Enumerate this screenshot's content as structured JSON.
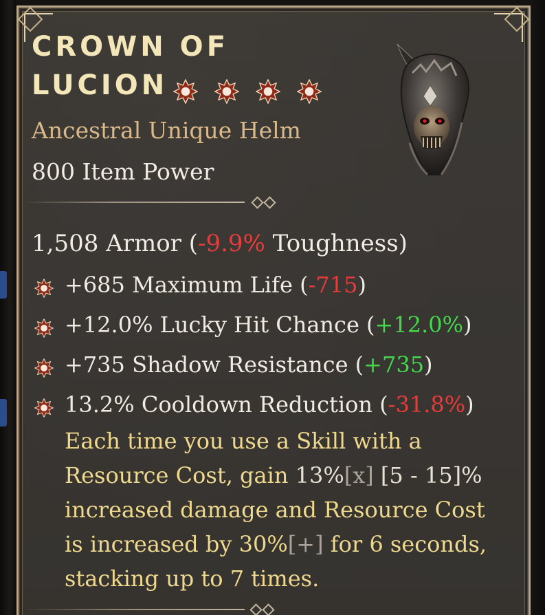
{
  "item": {
    "name_line1": "Crown of",
    "name_line2": "Lucion",
    "greater_affix_star_count": 4,
    "type": "Ancestral Unique Helm",
    "item_power": "800 Item Power",
    "icon": "helm-icon"
  },
  "armor": {
    "value_text": "1,508 Armor (",
    "delta": "-9.9%",
    "stat": " Toughness)"
  },
  "affixes": [
    {
      "icon": "greater-affix-star-icon",
      "text": "+685 Maximum Life (",
      "delta": "-715",
      "close": ")",
      "delta_kind": "negative"
    },
    {
      "icon": "greater-affix-star-icon",
      "text": "+12.0% Lucky Hit Chance (",
      "delta": "+12.0%",
      "close": ")",
      "delta_kind": "positive"
    },
    {
      "icon": "greater-affix-star-icon",
      "text": "+735 Shadow Resistance (",
      "delta": "+735",
      "close": ")",
      "delta_kind": "positive"
    },
    {
      "icon": "greater-affix-star-icon",
      "text": "13.2% Cooldown Reduction (",
      "delta": "-31.8%",
      "close": ")",
      "delta_kind": "negative"
    }
  ],
  "unique_power": {
    "part1": "Each time you use a Skill with a Resource Cost, gain ",
    "value1": "13%",
    "tag1": "[x]",
    "range1": " [5 - 15]%",
    "part2": " increased damage and Resource Cost is increased by ",
    "value2": "30%",
    "tag2": "[+]",
    "part3": " for 6 seconds, stacking up to 7 times."
  },
  "colors": {
    "title": "#f3e6b8",
    "unique_type": "#d9b98a",
    "unique_power": "#efd98f",
    "negative": "#ea3b3b",
    "positive": "#41d84a",
    "frame": "#b9a98a"
  }
}
